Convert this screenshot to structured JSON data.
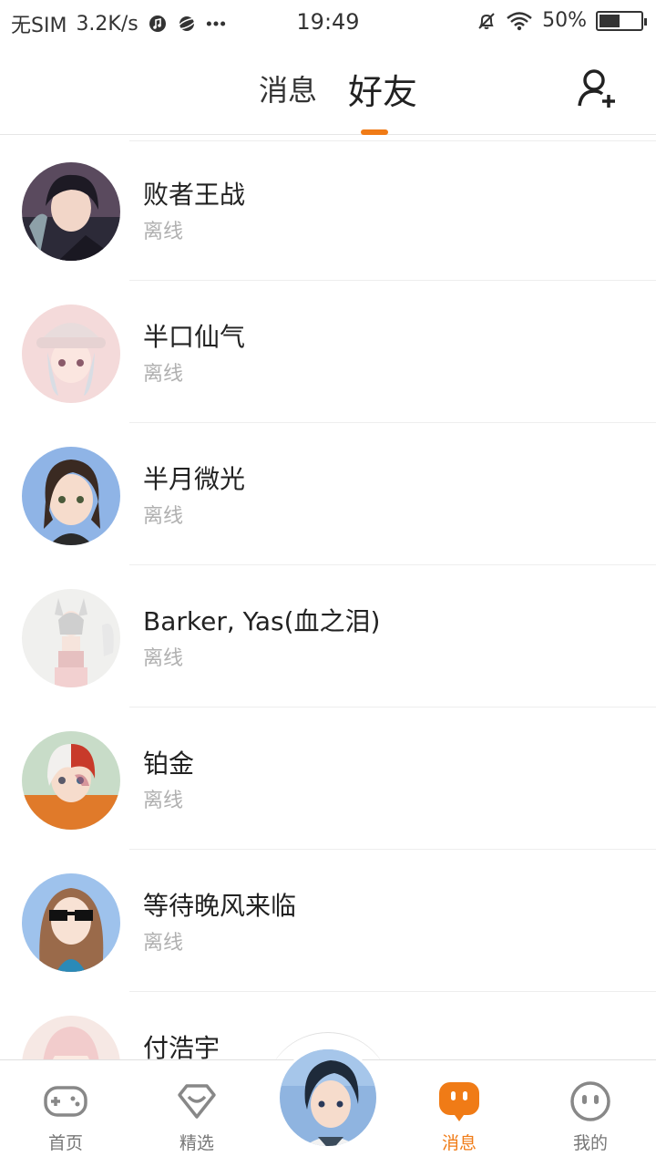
{
  "status_bar": {
    "carrier": "无SIM",
    "speed": "3.2K/s",
    "time": "19:49",
    "battery_percent": "50%",
    "battery_level": 0.5,
    "icons": [
      "music-icon",
      "planet-icon",
      "more-icon",
      "mute-icon",
      "wifi-icon",
      "battery-icon"
    ]
  },
  "header": {
    "tabs": [
      {
        "label": "消息",
        "active": false
      },
      {
        "label": "好友",
        "active": true
      }
    ],
    "add_friend_icon": "add-user-icon"
  },
  "colors": {
    "accent": "#f07b16",
    "offline_text": "#b0b0b0"
  },
  "friends": [
    {
      "name": "败者王战",
      "status": "离线",
      "avatar": "avatar-dark-hair"
    },
    {
      "name": "半口仙气",
      "status": "离线",
      "avatar": "avatar-white-hat"
    },
    {
      "name": "半月微光",
      "status": "离线",
      "avatar": "avatar-brown-hair"
    },
    {
      "name": "Barker, Yas(血之泪)",
      "status": "离线",
      "avatar": "avatar-fox-girl"
    },
    {
      "name": "铂金",
      "status": "离线",
      "avatar": "avatar-red-white"
    },
    {
      "name": "等待晚风来临",
      "status": "离线",
      "avatar": "avatar-sunglasses"
    },
    {
      "name": "付浩宇",
      "status": "",
      "avatar": "avatar-pink-hair"
    }
  ],
  "bottom_nav": {
    "items": [
      {
        "label": "首页",
        "icon": "gamepad-icon",
        "active": false
      },
      {
        "label": "精选",
        "icon": "heart-icon",
        "active": false
      },
      {
        "label": "消息",
        "icon": "chat-icon",
        "active": true
      },
      {
        "label": "我的",
        "icon": "face-icon",
        "active": false
      }
    ],
    "center_avatar": "avatar-user"
  }
}
